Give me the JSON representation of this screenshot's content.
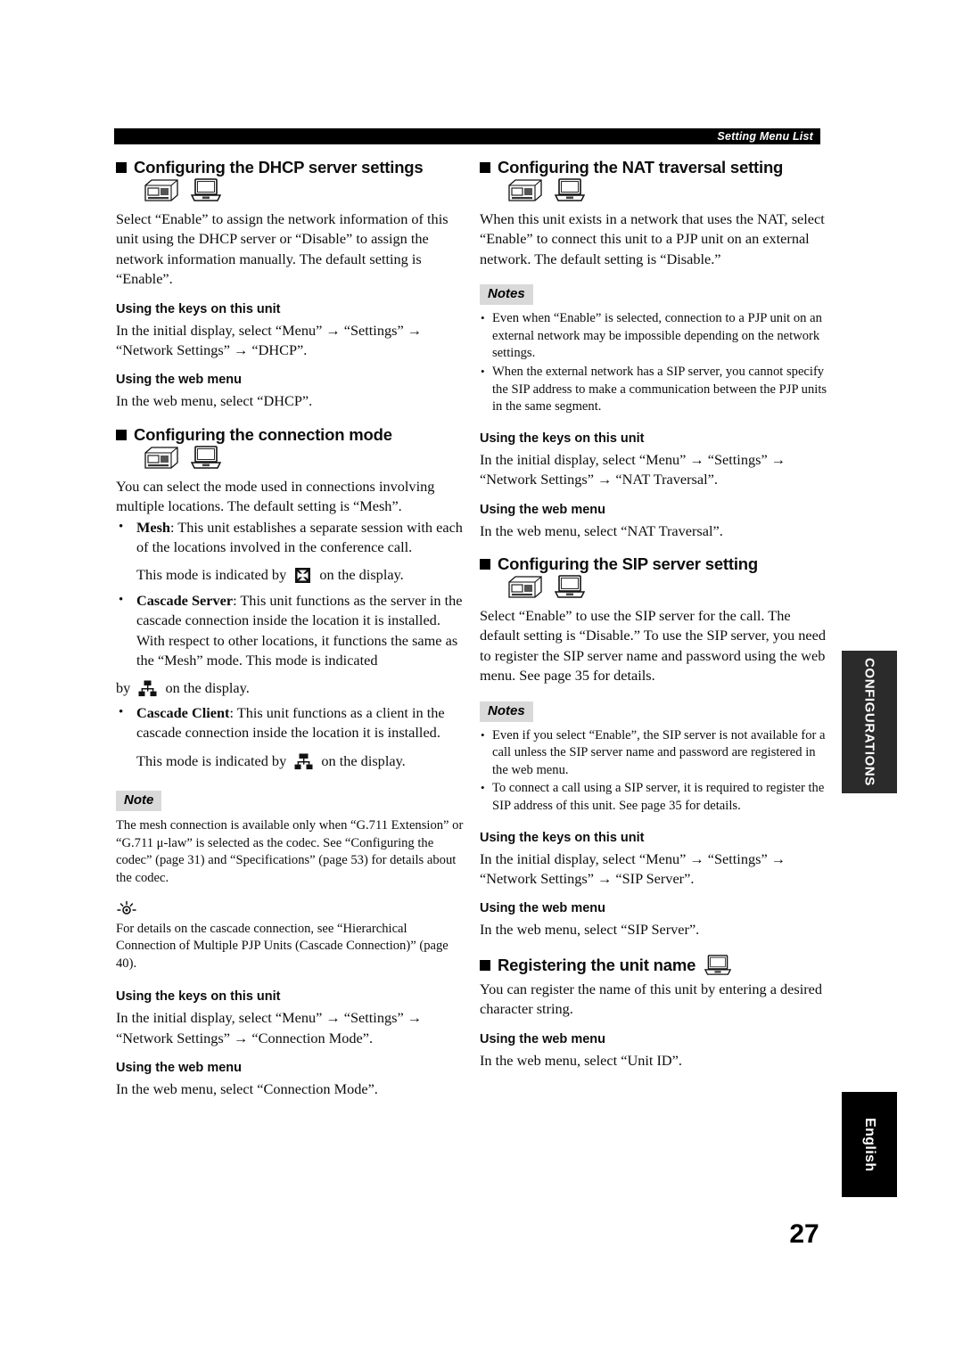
{
  "header": {
    "title": "Setting Menu List"
  },
  "page_number": "27",
  "side_tabs": {
    "configurations": "CONFIGURATIONS",
    "language": "English"
  },
  "icons": {
    "console": "conference-console-icon",
    "laptop": "laptop-icon",
    "mesh": "mesh-mode-icon",
    "cascade_server": "cascade-server-icon",
    "cascade_client": "cascade-client-icon",
    "tip": "tip-bulb-icon"
  },
  "labels": {
    "note": "Note",
    "notes": "Notes",
    "using_keys": "Using the keys on this unit",
    "using_web": "Using the web menu"
  },
  "left_column": {
    "dhcp": {
      "heading": "Configuring the DHCP server settings",
      "body": "Select “Enable” to assign the network information of this unit using the DHCP server or “Disable” to assign the network information manually. The default setting is “Enable”.",
      "keys_text": "In the initial display, select “Menu” → “Settings” → “Network Settings” → “DHCP”.",
      "web_text": "In the web menu, select “DHCP”."
    },
    "connection_mode": {
      "heading": "Configuring the connection mode",
      "body": "You can select the mode used in connections involving multiple locations. The default setting is “Mesh”.",
      "items": [
        {
          "term": "Mesh",
          "text": ": This unit establishes a separate session with each of the locations involved in the conference call.",
          "display_note_before": "This mode is indicated by",
          "display_note_after": "on the display."
        },
        {
          "term": "Cascade Server",
          "text": ": This unit functions as the server in the cascade connection inside the location it is installed. With respect to other locations, it functions the same as the “Mesh” mode. This mode is indicated",
          "display_note_before": "by",
          "display_note_after": "on the display."
        },
        {
          "term": "Cascade Client",
          "text": ": This unit functions as a client in the cascade connection inside the location it is installed.",
          "display_note_before": "This mode is indicated by",
          "display_note_after": "on the display."
        }
      ],
      "note_body": "The mesh connection is available only when “G.711 Extension” or “G.711 μ-law” is selected as the codec. See “Configuring the codec” (page 31) and “Specifications” (page 53) for details about the codec.",
      "tip_body": "For details on the cascade connection, see “Hierarchical Connection of Multiple PJP Units (Cascade Connection)” (page 40).",
      "keys_text": "In the initial display, select “Menu” → “Settings” → “Network Settings” → “Connection Mode”.",
      "web_text": "In the web menu, select “Connection Mode”."
    }
  },
  "right_column": {
    "nat": {
      "heading": "Configuring the NAT traversal setting",
      "body": "When this unit exists in a network that uses the NAT, select “Enable” to connect this unit to a PJP unit on an external network. The default setting is “Disable.”",
      "notes": [
        "Even when “Enable” is selected, connection to a PJP unit on an external network may be impossible depending on the network settings.",
        "When the external network has a SIP server, you cannot specify the SIP address to make a communication between the PJP units in the same segment."
      ],
      "keys_text": "In the initial display, select “Menu” → “Settings” → “Network Settings” → “NAT Traversal”.",
      "web_text": "In the web menu, select “NAT Traversal”."
    },
    "sip": {
      "heading": "Configuring the SIP server setting",
      "body": "Select “Enable” to use the SIP server for the call. The default setting is “Disable.” To use the SIP server, you need to register the SIP server name and password using the web menu. See page 35 for details.",
      "notes": [
        "Even if you select “Enable”, the SIP server is not available for a call unless the SIP server name and password are registered in the web menu.",
        "To connect a call using a SIP server, it is required to register the SIP address of this unit. See page 35 for details."
      ],
      "keys_text": "In the initial display, select “Menu” → “Settings” → “Network Settings” → “SIP Server”.",
      "web_text": "In the web menu, select “SIP Server”."
    },
    "unit_name": {
      "heading": "Registering the unit name",
      "body": "You can register the name of this unit by entering a desired character string.",
      "web_text": "In the web menu, select “Unit ID”."
    }
  }
}
